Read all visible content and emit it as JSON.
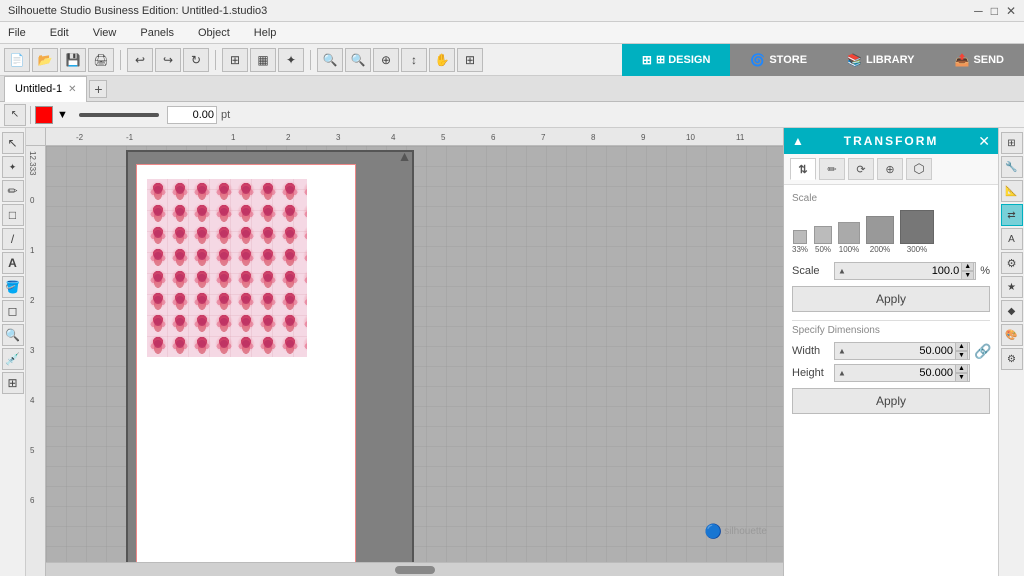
{
  "titlebar": {
    "title": "Silhouette Studio Business Edition: Untitled-1.studio3",
    "minimize": "─",
    "maximize": "□",
    "close": "✕"
  },
  "menubar": {
    "items": [
      "File",
      "Edit",
      "View",
      "Panels",
      "Object",
      "Help"
    ]
  },
  "toolbar2": {
    "value": "0.00",
    "unit": "pt"
  },
  "tabs": {
    "tab1": "Untitled-1"
  },
  "nav": {
    "design": "⊞ DESIGN",
    "store": "🔵 STORE",
    "library": "📚 LIBRARY",
    "send": "📤 SEND"
  },
  "transform": {
    "title": "TRANSFORM",
    "tabs": [
      "⇅⇄",
      "✏",
      "⟳",
      "⊕",
      "⬡"
    ],
    "scale_label": "Scale",
    "presets": [
      {
        "size": "s",
        "label": "33%"
      },
      {
        "size": "m",
        "label": "50%"
      },
      {
        "size": "l",
        "label": "100%"
      },
      {
        "size": "xl",
        "label": "200%"
      },
      {
        "size": "xxl",
        "label": "300%"
      }
    ],
    "scale_field_label": "Scale",
    "scale_value": "100.0",
    "scale_unit": "%",
    "apply1": "Apply",
    "specify_label": "Specify Dimensions",
    "width_label": "Width",
    "width_value": "50.000",
    "height_label": "Height",
    "height_value": "50.000",
    "apply2": "Apply"
  }
}
